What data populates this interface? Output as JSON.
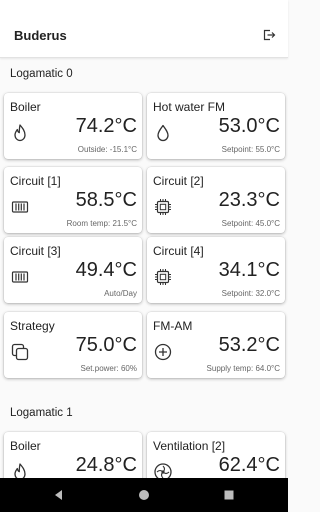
{
  "app": {
    "title": "Buderus"
  },
  "sections": [
    {
      "title": "Logamatic 0",
      "cards": [
        {
          "name": "Boiler",
          "value": "74.2°C",
          "sub": "Outside: -15.1°C",
          "icon": "flame-icon"
        },
        {
          "name": "Hot water FM",
          "value": "53.0°C",
          "sub": "Setpoint: 55.0°C",
          "icon": "water-drop-icon"
        },
        {
          "name": "Circuit [1]",
          "value": "58.5°C",
          "sub": "Room temp: 21.5°C",
          "icon": "radiator-icon"
        },
        {
          "name": "Circuit [2]",
          "value": "23.3°C",
          "sub": "Setpoint: 45.0°C",
          "icon": "chip-icon"
        },
        {
          "name": "Circuit [3]",
          "value": "49.4°C",
          "sub": "Auto/Day",
          "icon": "radiator-icon"
        },
        {
          "name": "Circuit [4]",
          "value": "34.1°C",
          "sub": "Setpoint: 32.0°C",
          "icon": "chip-icon"
        },
        {
          "name": "Strategy",
          "value": "75.0°C",
          "sub": "Set.power: 60%",
          "icon": "layers-icon"
        },
        {
          "name": "FM-AM",
          "value": "53.2°C",
          "sub": "Supply temp: 64.0°C",
          "icon": "plus-circle-icon"
        }
      ]
    },
    {
      "title": "Logamatic 1",
      "cards": [
        {
          "name": "Boiler",
          "value": "24.8°C",
          "sub": "",
          "icon": "flame-icon"
        },
        {
          "name": "Ventilation [2]",
          "value": "62.4°C",
          "sub": "",
          "icon": "fan-icon"
        }
      ]
    }
  ],
  "nav": {
    "back": "back-icon",
    "home": "home-icon",
    "recents": "recents-icon"
  }
}
